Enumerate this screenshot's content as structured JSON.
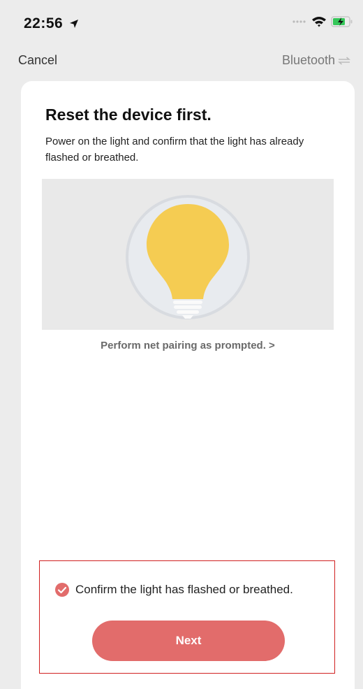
{
  "status_bar": {
    "time": "22:56",
    "icons": [
      "location-arrow-icon",
      "signal-dots-icon",
      "wifi-icon",
      "battery-charging-icon"
    ]
  },
  "nav": {
    "cancel_label": "Cancel",
    "bluetooth_label": "Bluetooth"
  },
  "main": {
    "title": "Reset the device first.",
    "description": "Power on the light and confirm that the light has already flashed or breathed.",
    "illustration_icon": "light-bulb-icon",
    "pairing_link": "Perform net pairing as prompted. >"
  },
  "footer": {
    "confirm_label": "Confirm the light has flashed or breathed.",
    "confirm_checked": true,
    "next_label": "Next"
  },
  "colors": {
    "accent": "#e26c6b",
    "highlight_border": "#d02020",
    "bulb": "#f5cc52"
  }
}
